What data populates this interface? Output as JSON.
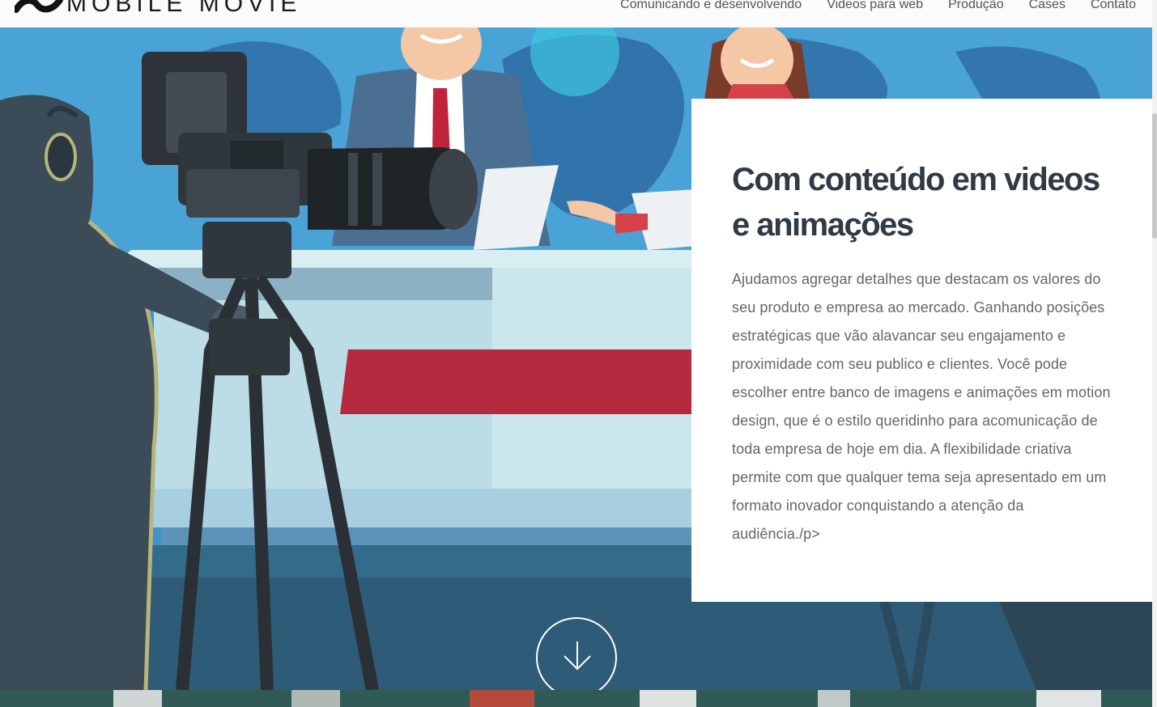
{
  "brand": {
    "name": "MOBILE MOVIE"
  },
  "nav": {
    "items": [
      {
        "label": "Comunicando e desenvolvendo"
      },
      {
        "label": "Videos para web"
      },
      {
        "label": "Produção"
      },
      {
        "label": "Cases"
      },
      {
        "label": "Contato"
      }
    ]
  },
  "hero": {
    "title": "Com conteúdo em videos e animações",
    "text": "Ajudamos agregar detalhes que destacam os valores do seu produto e empresa ao mercado. Ganhando posições estratégicas que vão alavancar seu engajamento e proximidade com seu publico e clientes. Você pode escolher entre banco de imagens e animações em motion design, que é o estilo queridinho para acomunicação de toda empresa de hoje em dia. A flexibilidade criativa permite com que qualquer tema seja apresentado em um formato inovador conquistando a atenção da audiência./p>",
    "illustration": "news-studio-illustration",
    "scroll_icon": "arrow-down-icon"
  },
  "colors": {
    "card_title": "#2f3a45",
    "card_text": "#666666",
    "hero_bg": "#3f95c9",
    "desk_red": "#b52a3e"
  }
}
